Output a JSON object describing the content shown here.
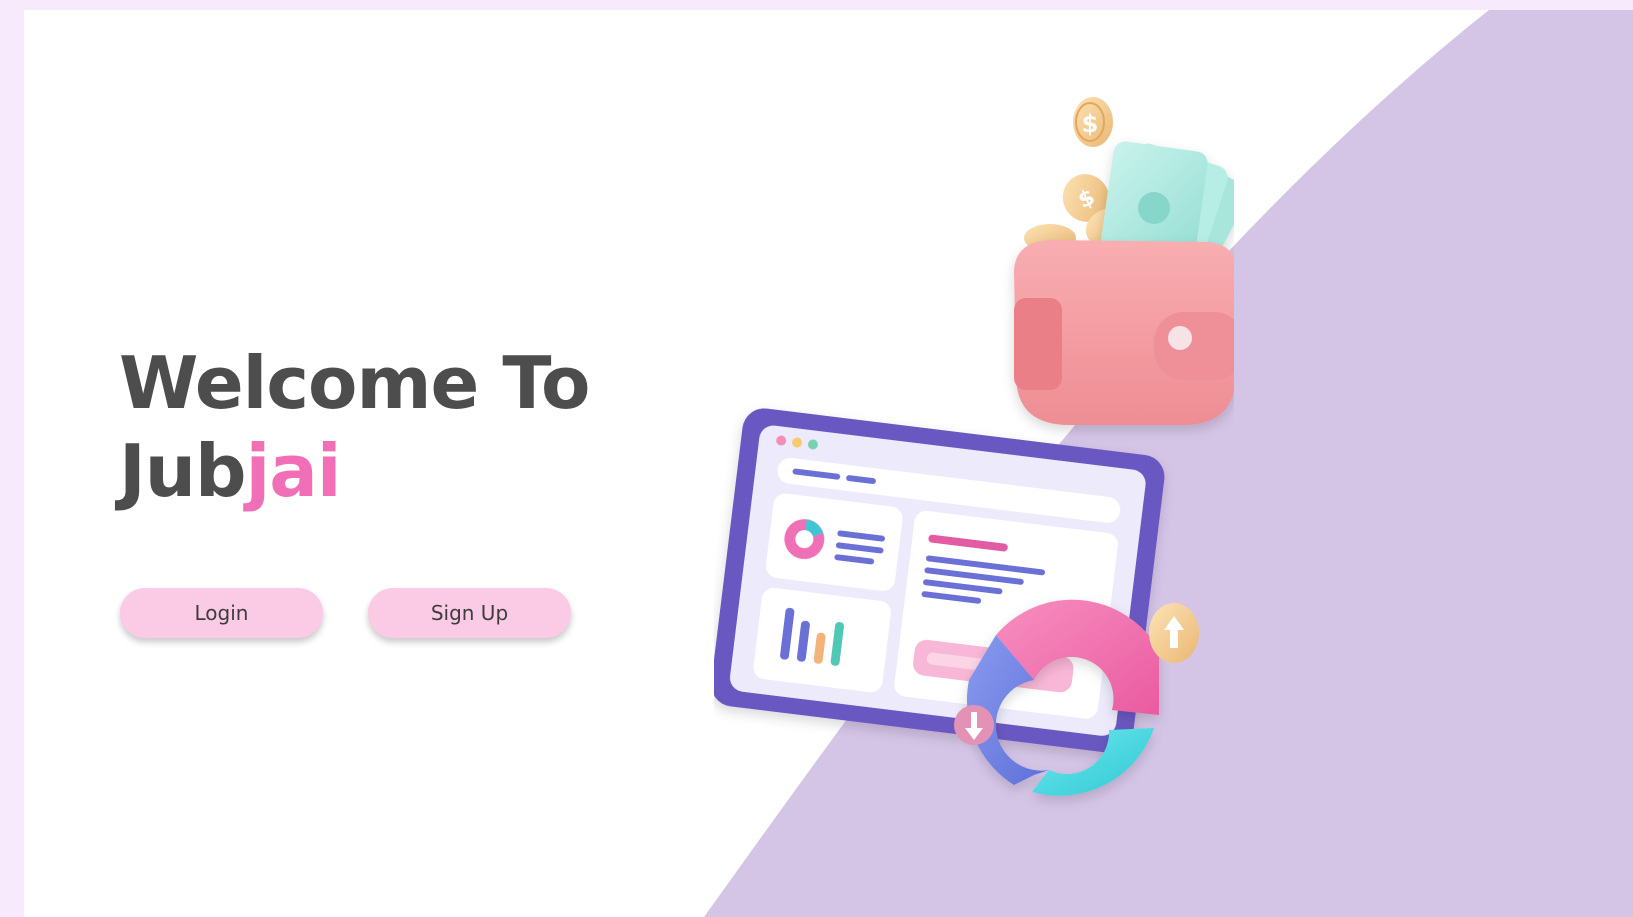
{
  "hero": {
    "title_line_1": "Welcome To",
    "title_line_2_prefix": "Jub",
    "title_line_2_accent": "jai"
  },
  "actions": {
    "login_label": "Login",
    "signup_label": "Sign Up"
  },
  "illustration": {
    "coin_symbol": "$"
  },
  "colors": {
    "page_background": "#f6eafc",
    "panel_background": "#ffffff",
    "diagonal_shape": "#d4c4e6",
    "title_text": "#4d4d4d",
    "brand_accent": "#f06fb6",
    "button_fill": "#fbcbe6",
    "button_text": "#3d3d3d"
  }
}
